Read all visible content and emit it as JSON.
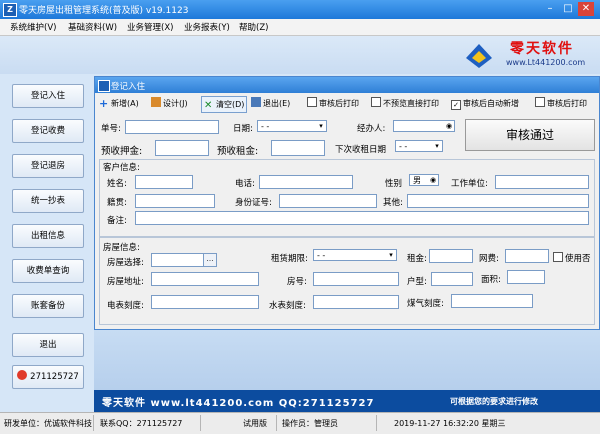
{
  "window": {
    "title": "零天房屋出租管理系统(普及版)  v19.1123",
    "icon_letter": "Z"
  },
  "menu": [
    "系统维护(V)",
    "基础资料(W)",
    "业务管理(X)",
    "业务报表(Y)",
    "帮助(Z)"
  ],
  "logo": {
    "text": "零天软件",
    "url": "www.Lt441200.com"
  },
  "sidebar": {
    "buttons": [
      "登记入住",
      "登记收费",
      "登记退房",
      "统一抄表",
      "出租信息",
      "收费单查询",
      "账套备份",
      "退出"
    ],
    "qq_label": "271125727"
  },
  "dialog": {
    "title": "登记入住",
    "toolbar": {
      "new": "新增(A)",
      "design": "设计(J)",
      "clear": "清空(D)",
      "exit": "退出(E)",
      "chk_print_after_review": "审核后打印",
      "chk_direct_print": "不预览直接打印",
      "chk_auto_new": "审核后自动新增",
      "chk_print_after_review2": "审核后打印"
    },
    "review_button": "审核通过",
    "top": {
      "doc_no_label": "单号:",
      "date_label": "日期:",
      "date_value": "- -",
      "handler_label": "经办人:",
      "deposit_label": "预收押金:",
      "rent_label": "预收租金:",
      "next_date_label": "下次收租日期",
      "next_date_value": "- -"
    },
    "customer": {
      "section": "客户信息:",
      "name": "姓名:",
      "phone": "电话:",
      "gender": "性别",
      "gender_value": "男",
      "employer": "工作单位:",
      "native": "籍贯:",
      "id_no": "身份证号:",
      "other": "其他:",
      "note": "备注:"
    },
    "house": {
      "section": "房屋信息:",
      "select": "房屋选择:",
      "lease_term": "租赁期限:",
      "lease_term_value": "- -",
      "rent": "租金:",
      "net_fee": "网费:",
      "use_no": "使用否",
      "address": "房屋地址:",
      "room_no": "房号:",
      "layout": "户型:",
      "area": "面积:",
      "meter_e": "电表刻度:",
      "meter_w": "水表刻度:",
      "meter_g": "煤气刻度:"
    }
  },
  "footer_banner": {
    "text": "零天软件  www.lt441200.com  QQ:271125727",
    "slogan": "可根据您的要求进行修改"
  },
  "status": {
    "company": "研发单位：优诚软件科技",
    "qq": "联系QQ：271125727",
    "edition": "试用版",
    "operator": "操作员：管理员",
    "datetime": "2019-11-27 16:32:20 星期三"
  },
  "colors": {
    "titlebar": "#1d78d9",
    "logo_red": "#e01010",
    "footer_bg": "#0c4c9f"
  }
}
